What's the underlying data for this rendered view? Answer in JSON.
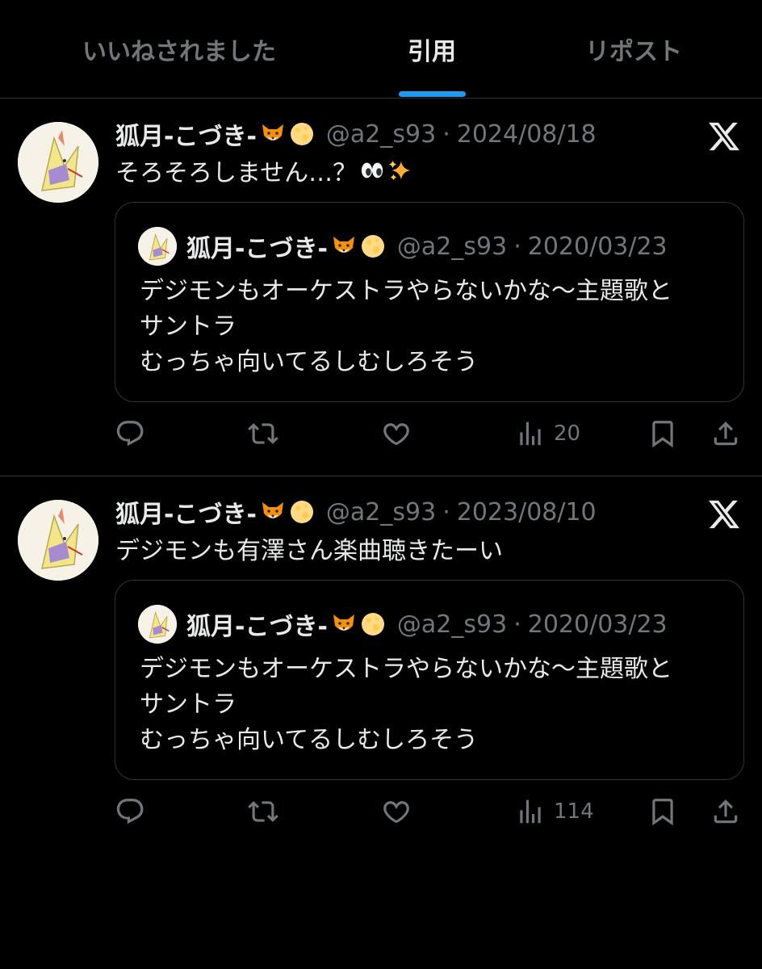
{
  "tabs": [
    {
      "label": "いいねされました"
    },
    {
      "label": "引用"
    },
    {
      "label": "リポスト"
    }
  ],
  "tweets": [
    {
      "display_name": "狐月-こづき-",
      "handle": "@a2_s93",
      "date": "2024/08/18",
      "text": "そろそろしません…？",
      "views": "20",
      "quote": {
        "display_name": "狐月-こづき-",
        "handle": "@a2_s93",
        "date": "2020/03/23",
        "lines": [
          "デジモンもオーケストラやらないかな〜主題歌と",
          "サントラ",
          "むっちゃ向いてるしむしろそう"
        ]
      }
    },
    {
      "display_name": "狐月-こづき-",
      "handle": "@a2_s93",
      "date": "2023/08/10",
      "text": "デジモンも有澤さん楽曲聴きたーい",
      "views": "114",
      "quote": {
        "display_name": "狐月-こづき-",
        "handle": "@a2_s93",
        "date": "2020/03/23",
        "lines": [
          "デジモンもオーケストラやらないかな〜主題歌と",
          "サントラ",
          "むっちゃ向いてるしむしろそう"
        ]
      }
    }
  ],
  "separator": "·",
  "icons": {
    "reply": "reply-icon",
    "repost": "repost-icon",
    "like": "heart-icon",
    "views": "views-icon",
    "bookmark": "bookmark-icon",
    "share": "share-icon",
    "x_logo": "x-logo-icon",
    "fox": "fox-emoji-icon",
    "moon": "moon-emoji-icon",
    "eyes": "eyes-emoji-icon",
    "sparkles": "sparkles-emoji-icon"
  },
  "colors": {
    "background": "#000000",
    "text": "#e7e9ea",
    "muted": "#71767b",
    "accent": "#1d9bf0",
    "border": "#2f3336"
  }
}
